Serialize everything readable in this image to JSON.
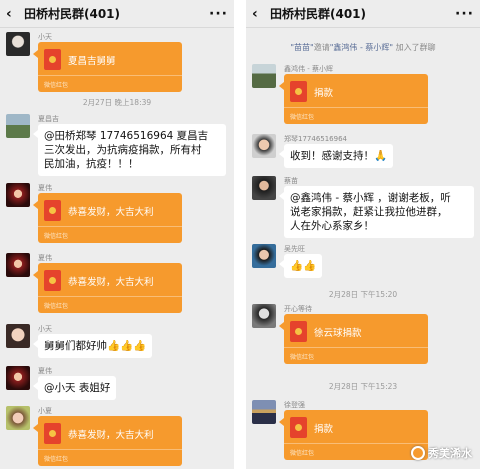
{
  "left": {
    "title": "田桥村民群(401)",
    "back_icon": "chevron-left-icon",
    "more_icon": "more-dots-icon",
    "messages": [
      {
        "sender": "小天",
        "kind": "redpacket",
        "text": "夏昌吉舅舅",
        "footer": "微信红包"
      },
      {
        "kind": "timestamp",
        "text": "2月27日 晚上18:39"
      },
      {
        "sender": "夏昌吉",
        "kind": "text",
        "lines": [
          "@田桥郑琴 17746516964  夏昌吉",
          "三次发出，为抗病疫捐款，所有村",
          "民加油，抗疫！！！"
        ]
      },
      {
        "sender": "夏伟",
        "kind": "redpacket",
        "text": "恭喜发财，大吉大利",
        "footer": "微信红包"
      },
      {
        "sender": "夏伟",
        "kind": "redpacket",
        "text": "恭喜发财，大吉大利",
        "footer": "微信红包"
      },
      {
        "sender": "小天",
        "kind": "text",
        "lines": [
          "舅舅们都好帅👍👍👍"
        ]
      },
      {
        "sender": "夏伟",
        "kind": "text",
        "lines": [
          "@小天  表姐好"
        ]
      },
      {
        "sender": "小夏",
        "kind": "redpacket",
        "text": "恭喜发财，大吉大利",
        "footer": "微信红包"
      }
    ]
  },
  "right": {
    "title": "田桥村民群(401)",
    "back_icon": "chevron-left-icon",
    "more_icon": "more-dots-icon",
    "sys": {
      "n1": "\"苗苗\"",
      "verb": "邀请",
      "n2": "\"鑫鸿伟 - 蔡小辉\"",
      "tail": "加入了群聊"
    },
    "messages": [
      {
        "sender": "鑫鸿伟 - 蔡小辉",
        "kind": "redpacket",
        "text": "捐款",
        "footer": "微信红包"
      },
      {
        "sender": "郑琴17746516964",
        "kind": "text",
        "lines": [
          "收到！感谢支持！🙏"
        ]
      },
      {
        "sender": "蔡苗",
        "kind": "text",
        "lines": [
          "@鑫鸿伟 - 蔡小辉 ，谢谢老板，听",
          "说老家捐款，赶紧让我拉他进群，",
          "人在外心系家乡！"
        ]
      },
      {
        "sender": "吴先旺",
        "kind": "text",
        "lines": [
          "👍👍"
        ]
      },
      {
        "kind": "timestamp",
        "text": "2月28日 下午15:20"
      },
      {
        "sender": "开心等待",
        "kind": "redpacket",
        "text": "徐云球捐款",
        "footer": "微信红包"
      },
      {
        "kind": "timestamp",
        "text": "2月28日 下午15:23"
      },
      {
        "sender": "徐登强",
        "kind": "redpacket",
        "text": "捐款",
        "footer": "微信红包"
      }
    ]
  },
  "watermark": {
    "text": "秀美浠水",
    "icon": "wechat-official-logo-icon"
  },
  "colors": {
    "chat_bg": "#ededed",
    "redpacket": "#f69a2d",
    "sys_name": "#576b95"
  }
}
